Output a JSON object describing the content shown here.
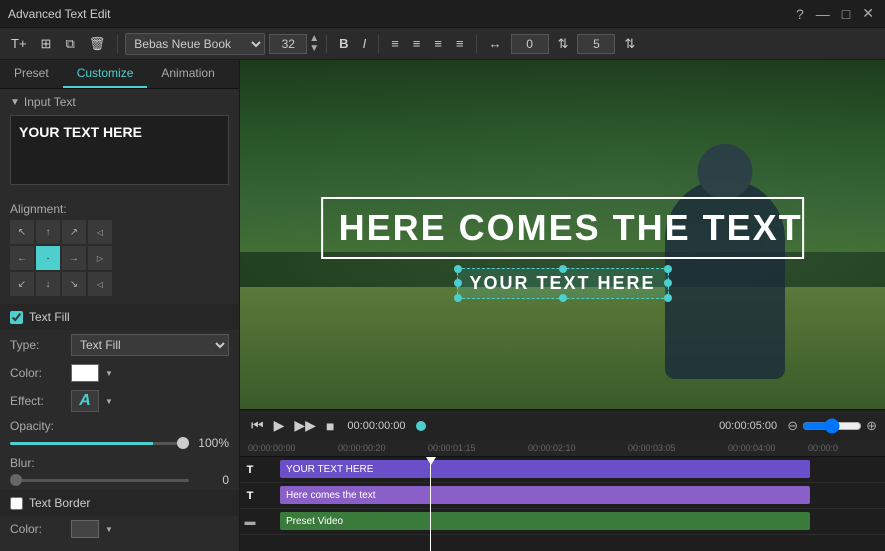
{
  "window": {
    "title": "Advanced Text Edit"
  },
  "title_bar_controls": {
    "help": "?",
    "minimize": "—",
    "maximize": "□",
    "close": "✕"
  },
  "tabs": {
    "preset": "Preset",
    "customize": "Customize",
    "animation": "Animation"
  },
  "toolbar": {
    "add_text": "T+",
    "add_box": "⊞",
    "copy": "⧉",
    "delete": "🗑",
    "font": "Bebas Neue Book",
    "size": "32",
    "bold": "B",
    "italic": "I",
    "align_left": "≡",
    "align_center": "≡",
    "align_right": "≡",
    "justify": "≡",
    "spacing": "↔",
    "number1": "0",
    "arrows_up": "⇅",
    "number2": "5",
    "arrows_up2": "⇅"
  },
  "left_panel": {
    "input_text_label": "Input Text",
    "text_value": "YOUR TEXT HERE",
    "alignment_label": "Alignment:",
    "alignment_buttons": [
      "↖",
      "↑",
      "↗",
      "⟵",
      "←",
      "·",
      "→",
      "⟶",
      "↙",
      "↓",
      "↘",
      "⟵"
    ],
    "text_fill_label": "Text Fill",
    "type_label": "Type:",
    "type_value": "Text Fill",
    "color_label": "Color:",
    "effect_label": "Effect:",
    "effect_letter": "A",
    "opacity_label": "Opacity:",
    "opacity_value": "100%",
    "blur_label": "Blur:",
    "blur_value": "0",
    "text_border_label": "Text Border",
    "border_color_label": "Color:"
  },
  "preview": {
    "big_text": "HERE COMES THE TEXT",
    "small_text": "YOUR TEXT HERE"
  },
  "playback": {
    "time_current": "00:00:00:00",
    "time_end": "00:00:05:00",
    "zoom_minus": "⊖",
    "zoom_plus": "⊕"
  },
  "timeline": {
    "ruler_times": [
      "00:00:00:00",
      "00:00:00:20",
      "00:00:01:15",
      "00:00:02:10",
      "00:00:03:05",
      "00:00:04:00",
      "00:00:0"
    ],
    "track1_label": "T",
    "track1_clip": "YOUR TEXT HERE",
    "track2_label": "T",
    "track2_clip": "Here comes the text",
    "track3_label": "▬",
    "track3_clip": "Preset Video"
  }
}
